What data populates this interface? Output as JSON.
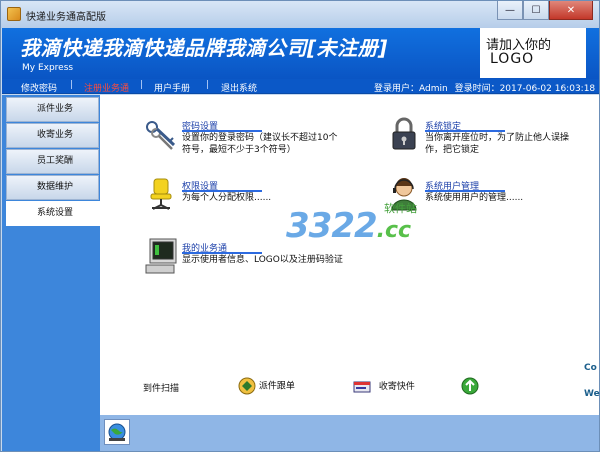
{
  "window": {
    "title": "快递业务通高配版",
    "close_glyph": "✕",
    "min_glyph": "—",
    "max_glyph": "☐"
  },
  "banner": {
    "title": "我滴快递我滴快递品牌我滴公司[未注册]",
    "subtitle": "My Express",
    "logo_line1": "请加入你的",
    "logo_line2": "LOGO"
  },
  "menu": {
    "items": [
      {
        "label": "修改密码",
        "active": false
      },
      {
        "label": "注册业务通",
        "active": true
      },
      {
        "label": "用户手册",
        "active": false
      },
      {
        "label": "退出系统",
        "active": false
      }
    ],
    "separator": "|",
    "login_user_label": "登录用户：Admin",
    "login_time_label": "登录时间：2017-06-02 16:03:18"
  },
  "sidebar": {
    "items": [
      {
        "label": "派件业务"
      },
      {
        "label": "收寄业务"
      },
      {
        "label": "员工奖酬"
      },
      {
        "label": "数据维护"
      },
      {
        "label": "系统设置",
        "selected": true
      }
    ]
  },
  "functions": {
    "password": {
      "title": "密码设置",
      "desc": "设置你的登录密码（建议长不超过10个符号，最短不少于3个符号）",
      "icon": "keys-icon"
    },
    "lock": {
      "title": "系统锁定",
      "desc": "当你离开座位时，为了防止他人误操作，把它锁定",
      "icon": "padlock-icon"
    },
    "permission": {
      "title": "权限设置",
      "desc": "为每个人分配权限......",
      "icon": "chair-icon"
    },
    "users": {
      "title": "系统用户管理",
      "desc": "系统使用用户的管理......",
      "icon": "user-headset-icon"
    },
    "business": {
      "title": "我的业务通",
      "desc": "显示使用者信息、LOGO以及注册码验证",
      "icon": "computer-icon"
    }
  },
  "watermark": {
    "number": "3322",
    "domain": ".cc",
    "soft": "软件站"
  },
  "bottom_actions": [
    {
      "label": "到件扫描"
    },
    {
      "label": "派件跟单",
      "icon": "dispatch-icon"
    },
    {
      "label": "收寄快件",
      "icon": "parcel-icon"
    },
    {
      "label": "",
      "icon": "recycle-icon"
    }
  ],
  "cut_text": {
    "line1": "Co",
    "line2": "We"
  },
  "colors": {
    "banner": "#0a60d4",
    "menubar": "#0b58c7",
    "sidebar": "#3d86db",
    "active_menu": "#ff4c3c",
    "link": "#1a3ea8"
  }
}
